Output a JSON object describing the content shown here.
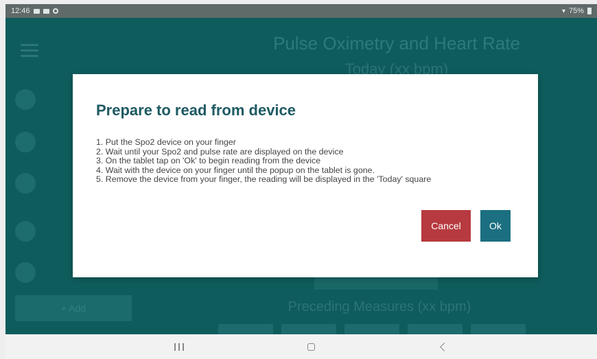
{
  "status_bar": {
    "time": "12:46",
    "battery": "75%"
  },
  "background": {
    "title": "Pulse Oximetry and Heart Rate",
    "subtitle": "Today (xx bpm)",
    "add_label": "+ Add",
    "preceding_title": "Preceding Measures (xx bpm)"
  },
  "dialog": {
    "title": "Prepare to read from device",
    "steps": [
      "1. Put the Spo2 device on your finger",
      "2. Wait until your Spo2 and pulse rate are displayed on the device",
      "3. On the tablet tap on 'Ok' to begin reading from the device",
      "4. Wait with the device on your finger until the popup on the tablet is gone.",
      "5. Remove the device from your finger, the reading will be displayed in the 'Today' square"
    ],
    "cancel_label": "Cancel",
    "ok_label": "Ok"
  },
  "colors": {
    "app_background": "#0f5c5d",
    "dialog_title": "#1e5a62",
    "cancel_button": "#b63a3f",
    "ok_button": "#1b6f80"
  },
  "icons": {
    "menu": "hamburger-menu-icon",
    "nav_recents": "recents-icon",
    "nav_home": "home-icon",
    "nav_back": "back-icon"
  }
}
